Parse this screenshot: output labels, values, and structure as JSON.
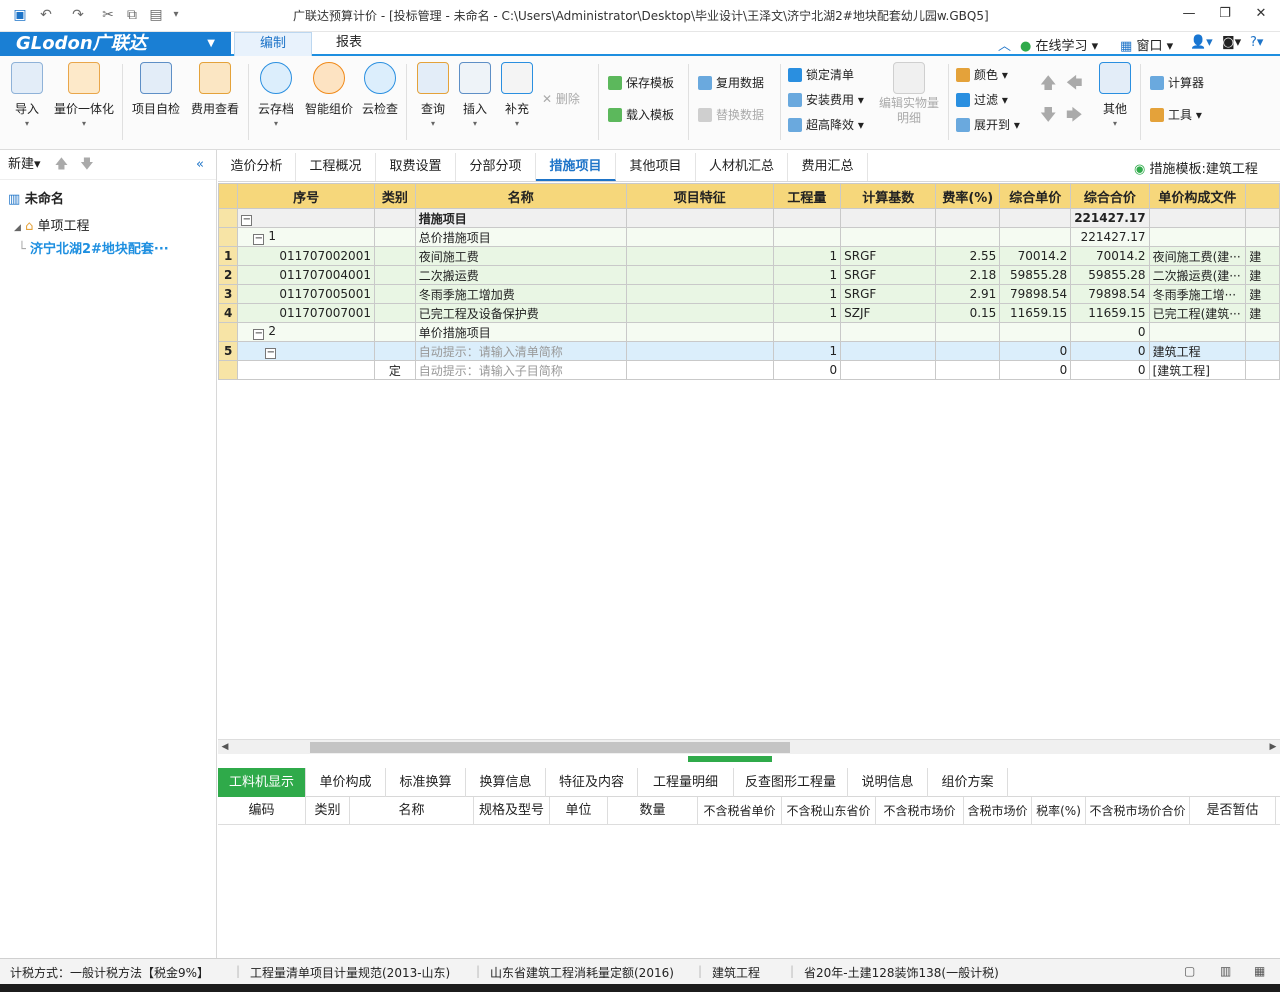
{
  "window": {
    "title": "广联达预算计价 - [投标管理 - 未命名 - C:\\Users\\Administrator\\Desktop\\毕业设计\\王泽文\\济宁北湖2#地块配套幼儿园w.GBQ5]",
    "minimize": "—",
    "restore": "❐",
    "close": "✕"
  },
  "quick_access": [
    "save-icon",
    "undo-icon",
    "redo-icon",
    "cut-icon",
    "copy-icon",
    "paste-icon",
    "more-icon"
  ],
  "menu": {
    "logo": "GLodon广联达",
    "tabs": [
      "编制",
      "报表"
    ],
    "right": {
      "learn": "在线学习",
      "window": "窗口",
      "help": "?"
    }
  },
  "ribbon": {
    "import": "导入",
    "price_integration": "量价一体化",
    "self_check": "项目自检",
    "fee_view": "费用查看",
    "cloud_save": "云存档",
    "smart_price": "智能组价",
    "cloud_check": "云检查",
    "query": "查询",
    "insert": "插入",
    "supplement": "补充",
    "delete": "删除",
    "save_template": "保存模板",
    "load_template": "载入模板",
    "reuse_data": "复用数据",
    "replace_data": "替换数据",
    "lock_list": "锁定清单",
    "install_fee": "安装费用",
    "high_rise": "超高降效",
    "edit_quantity": "编辑实物量明细",
    "color": "颜色",
    "filter": "过滤",
    "expand_to": "展开到",
    "other": "其他",
    "calculator": "计算器",
    "tools": "工具"
  },
  "left_panel": {
    "new": "新建",
    "root": "未命名",
    "unit": "单项工程",
    "project": "济宁北湖2#地块配套···"
  },
  "tabs": [
    "造价分析",
    "工程概况",
    "取费设置",
    "分部分项",
    "措施项目",
    "其他项目",
    "人材机汇总",
    "费用汇总"
  ],
  "active_tab": "措施项目",
  "template_label": "措施模板:建筑工程",
  "grid": {
    "headers": [
      "序号",
      "类别",
      "名称",
      "项目特征",
      "工程量",
      "计算基数",
      "费率(%)",
      "综合单价",
      "综合合价",
      "单价构成文件"
    ],
    "rows": [
      {
        "rn": "",
        "code": "",
        "type": "",
        "name": "措施项目",
        "feature": "",
        "qty": "",
        "base": "",
        "rate": "",
        "unit_price": "",
        "total": "221427.17",
        "file": "",
        "extra": ""
      },
      {
        "rn": "",
        "code": "1",
        "type": "",
        "name": "总价措施项目",
        "feature": "",
        "qty": "",
        "base": "",
        "rate": "",
        "unit_price": "",
        "total": "221427.17",
        "file": "",
        "extra": ""
      },
      {
        "rn": "1",
        "code": "011707002001",
        "type": "",
        "name": "夜间施工费",
        "feature": "",
        "qty": "1",
        "base": "SRGF",
        "rate": "2.55",
        "unit_price": "70014.2",
        "total": "70014.2",
        "file": "夜间施工费(建···",
        "extra": "建"
      },
      {
        "rn": "2",
        "code": "011707004001",
        "type": "",
        "name": "二次搬运费",
        "feature": "",
        "qty": "1",
        "base": "SRGF",
        "rate": "2.18",
        "unit_price": "59855.28",
        "total": "59855.28",
        "file": "二次搬运费(建···",
        "extra": "建"
      },
      {
        "rn": "3",
        "code": "011707005001",
        "type": "",
        "name": "冬雨季施工增加费",
        "feature": "",
        "qty": "1",
        "base": "SRGF",
        "rate": "2.91",
        "unit_price": "79898.54",
        "total": "79898.54",
        "file": "冬雨季施工增···",
        "extra": "建"
      },
      {
        "rn": "4",
        "code": "011707007001",
        "type": "",
        "name": "已完工程及设备保护费",
        "feature": "",
        "qty": "1",
        "base": "SZJF",
        "rate": "0.15",
        "unit_price": "11659.15",
        "total": "11659.15",
        "file": "已完工程(建筑···",
        "extra": "建"
      },
      {
        "rn": "",
        "code": "2",
        "type": "",
        "name": "单价措施项目",
        "feature": "",
        "qty": "",
        "base": "",
        "rate": "",
        "unit_price": "",
        "total": "0",
        "file": "",
        "extra": ""
      },
      {
        "rn": "5",
        "code": "",
        "type": "",
        "name": "自动提示：请输入清单简称",
        "feature": "",
        "qty": "1",
        "base": "",
        "rate": "",
        "unit_price": "0",
        "total": "0",
        "file": "建筑工程",
        "extra": ""
      },
      {
        "rn": "",
        "code": "",
        "type": "定",
        "name": "自动提示：请输入子目简称",
        "feature": "",
        "qty": "0",
        "base": "",
        "rate": "",
        "unit_price": "0",
        "total": "0",
        "file": "[建筑工程]",
        "extra": ""
      }
    ]
  },
  "bottom_tabs": [
    "工料机显示",
    "单价构成",
    "标准换算",
    "换算信息",
    "特征及内容",
    "工程量明细",
    "反查图形工程量",
    "说明信息",
    "组价方案"
  ],
  "bottom_headers": [
    "编码",
    "类别",
    "名称",
    "规格及型号",
    "单位",
    "数量",
    "不含税省单价",
    "不含税山东省价",
    "不含税市场价",
    "含税市场价",
    "税率(%)",
    "不含税市场价合价",
    "是否暂估"
  ],
  "status": {
    "tax": "计税方式：一般计税方法【税金9%】",
    "spec": "工程量清单项目计量规范(2013-山东)",
    "quota": "山东省建筑工程消耗量定额(2016)",
    "type": "建筑工程",
    "rule": "省20年-土建128装饰138(一般计税)"
  },
  "colors": {
    "brand": "#1a7fd4",
    "header": "#f6d77b",
    "active_bottom": "#2faa4a"
  }
}
